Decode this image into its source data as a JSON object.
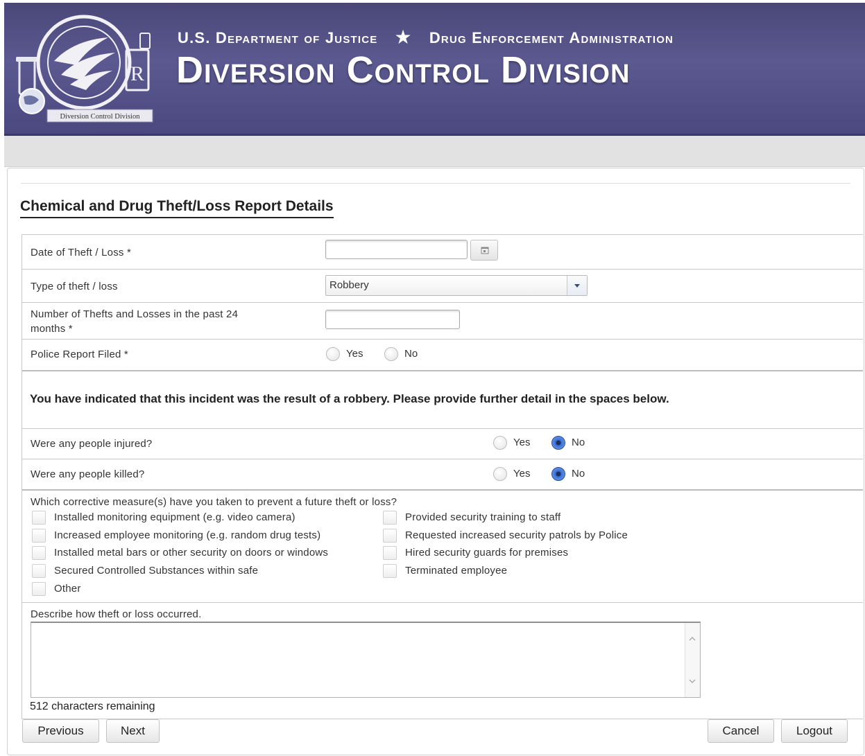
{
  "header": {
    "seal_text": "Diversion Control Division",
    "seal_ring_text": "U.S. Department of Justice · Drug Enforcement Administration",
    "dept_left": "U.S. Department of Justice",
    "dept_right": "Drug Enforcement Administration",
    "division_title": "Diversion Control Division"
  },
  "form": {
    "title": "Chemical and Drug Theft/Loss Report Details",
    "date_label": "Date of Theft / Loss *",
    "date_value": "",
    "type_label": "Type of theft / loss",
    "type_selected": "Robbery",
    "count_label_line1": "Number of Thefts and Losses in the past 24",
    "count_label_line2": "months *",
    "count_value": "",
    "police_label": "Police Report Filed *",
    "yes": "Yes",
    "no": "No",
    "notice": "You have indicated that this incident was the result of a robbery. Please provide further detail in the spaces below.",
    "injured_label": "Were any people injured?",
    "killed_label": "Were any people killed?",
    "measures_label": "Which corrective measure(s) have you taken to prevent a future theft or loss?",
    "measures_left": [
      "Installed monitoring equipment (e.g. video camera)",
      "Increased employee monitoring (e.g. random drug tests)",
      "Installed metal bars or other security on doors or windows",
      "Secured Controlled Substances within safe",
      "Other"
    ],
    "measures_right": [
      "Provided security training to staff",
      "Requested increased security patrols by Police",
      "Hired security guards for premises",
      "Terminated employee"
    ],
    "describe_label": "Describe how theft or loss occurred.",
    "describe_value": "",
    "chars_remaining": "512 characters remaining"
  },
  "buttons": {
    "previous": "Previous",
    "next": "Next",
    "cancel": "Cancel",
    "logout": "Logout"
  },
  "colors": {
    "header_bg": "#524f86",
    "radio_selected": "#3a6fd4"
  }
}
